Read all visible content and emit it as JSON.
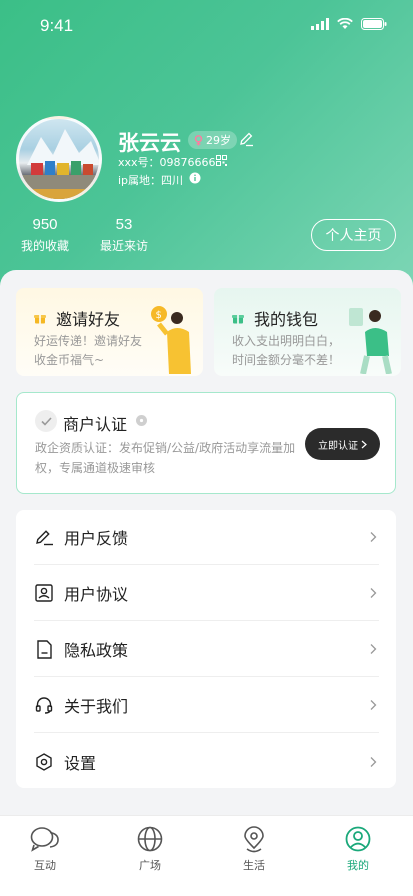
{
  "status_bar": {
    "time": "9:41"
  },
  "profile": {
    "name": "张云云",
    "age": "29岁",
    "id_text": "xxx号：09876666",
    "ip_text": "ip属地：四川",
    "stats": [
      {
        "value": "950",
        "label": "我的收藏"
      },
      {
        "value": "53",
        "label": "最近来访"
      }
    ],
    "home_button": "个人主页"
  },
  "promos": {
    "invite": {
      "title": "邀请好友",
      "desc": "好运传递！邀请好友收金币福气~"
    },
    "wallet": {
      "title": "我的钱包",
      "desc": "收入支出明明白白，时间金额分毫不差！"
    }
  },
  "merchant": {
    "title": "商户认证",
    "desc": "政企资质认证：发布促销/公益/政府活动享流量加权，专属通道极速审核",
    "button": "立即认证"
  },
  "menu": {
    "items": [
      {
        "label": "用户反馈",
        "icon": "edit-icon"
      },
      {
        "label": "用户协议",
        "icon": "contact-card-icon"
      },
      {
        "label": "隐私政策",
        "icon": "document-icon"
      },
      {
        "label": "关于我们",
        "icon": "headset-icon"
      },
      {
        "label": "设置",
        "icon": "settings-icon"
      }
    ]
  },
  "tabbar": {
    "tabs": [
      {
        "label": "互动",
        "icon": "chat-icon"
      },
      {
        "label": "广场",
        "icon": "globe-icon"
      },
      {
        "label": "生活",
        "icon": "location-icon"
      },
      {
        "label": "我的",
        "icon": "user-icon"
      }
    ],
    "active": "我的"
  },
  "colors": {
    "brand_green": "#3bbf87",
    "active_tab": "#1aa87a",
    "badge_pink": "#ff7aa0"
  }
}
